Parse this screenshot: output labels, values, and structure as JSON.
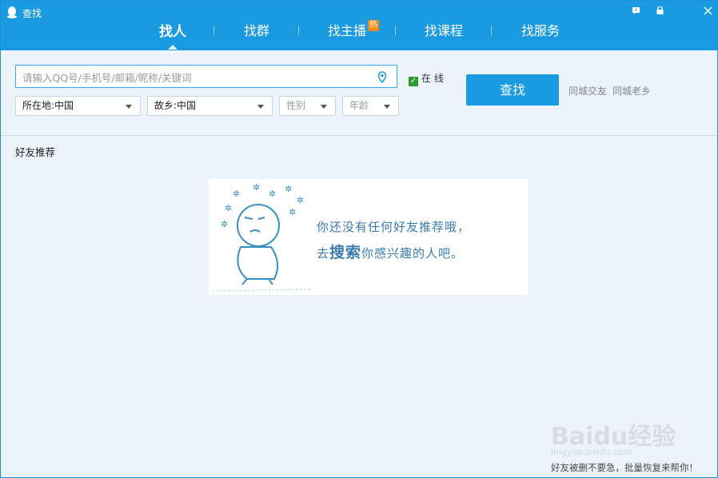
{
  "window": {
    "title": "查找"
  },
  "window_buttons": [
    "feedback-icon",
    "lock-icon",
    "close-icon"
  ],
  "tabs": [
    {
      "label": "找人",
      "active": true
    },
    {
      "label": "找群"
    },
    {
      "label": "找主播",
      "badge": "热"
    },
    {
      "label": "找课程"
    },
    {
      "label": "找服务"
    }
  ],
  "search": {
    "placeholder": "请输入QQ号/手机号/邮箱/昵称/关键词",
    "value": ""
  },
  "online_filter": {
    "label": "在 线",
    "checked": true
  },
  "filters": {
    "location": "所在地:中国",
    "hometown": "故乡:中国",
    "gender": "性别",
    "age": "年龄"
  },
  "search_button": "查找",
  "links": {
    "same_city": "同城交友",
    "same_home": "同城老乡"
  },
  "recommend": {
    "title": "好友推荐",
    "empty_line1": "你还没有任何好友推荐哦，",
    "empty_line2_prefix": "去",
    "empty_line2_emph": "搜索",
    "empty_line2_suffix": "你感兴趣的人吧。"
  },
  "watermark": {
    "brand": "Baidu经验",
    "url": "jingyan.baidu.com"
  },
  "footer_promo": "好友被删不要急，批量恢复来帮你！",
  "colors": {
    "accent": "#1a9ae0",
    "illustration_text": "#3a7bb0",
    "checkbox": "#2c9d2c",
    "hot_badge": "#f58a1f"
  }
}
